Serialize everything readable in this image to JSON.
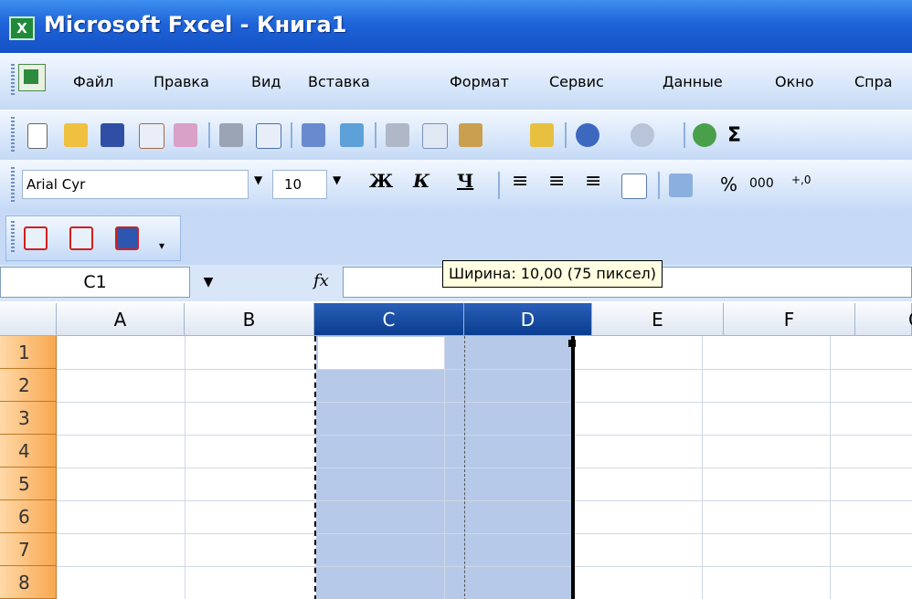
{
  "window": {
    "title": "Microsoft Fxcel - Книга1",
    "app_icon": "excel-app-icon"
  },
  "menu": [
    "Файл",
    "Правка",
    "Вид",
    "Вставка",
    "Формат",
    "Сервис",
    "Данные",
    "Окно",
    "Спра"
  ],
  "standard_toolbar": {
    "icons": [
      "new-icon",
      "open-icon",
      "save-icon",
      "permission-icon",
      "email-icon",
      "print-icon",
      "print-preview-icon",
      "spelling-icon",
      "research-icon",
      "cut-icon",
      "copy-icon",
      "paste-icon",
      "format-painter-icon",
      "undo-icon",
      "redo-icon",
      "hyperlink-icon",
      "autosum-icon"
    ]
  },
  "formatting_toolbar": {
    "font_name": "Arial Cyr",
    "font_size": "10",
    "bold_label": "Ж",
    "italic_label": "К",
    "underline_label": "Ч",
    "percent_label": "%",
    "thousands_label": "000",
    "increase_decimal_label": "+,0"
  },
  "pdf_toolbar": {
    "icons": [
      "pdf-convert-icon",
      "pdf-email-icon",
      "pdf-review-icon"
    ]
  },
  "formula_bar": {
    "name_box": "C1",
    "fx_label": "fx",
    "formula": ""
  },
  "tooltip": "Ширина: 10,00 (75 пиксел)",
  "sheet": {
    "columns": [
      "A",
      "B",
      "C",
      "D",
      "E",
      "F",
      "G"
    ],
    "selected_columns": [
      "C",
      "D"
    ],
    "rows": [
      "1",
      "2",
      "3",
      "4",
      "5",
      "6",
      "7",
      "8"
    ],
    "active_cell": "C1",
    "selection_color": "#b6c9e8"
  }
}
